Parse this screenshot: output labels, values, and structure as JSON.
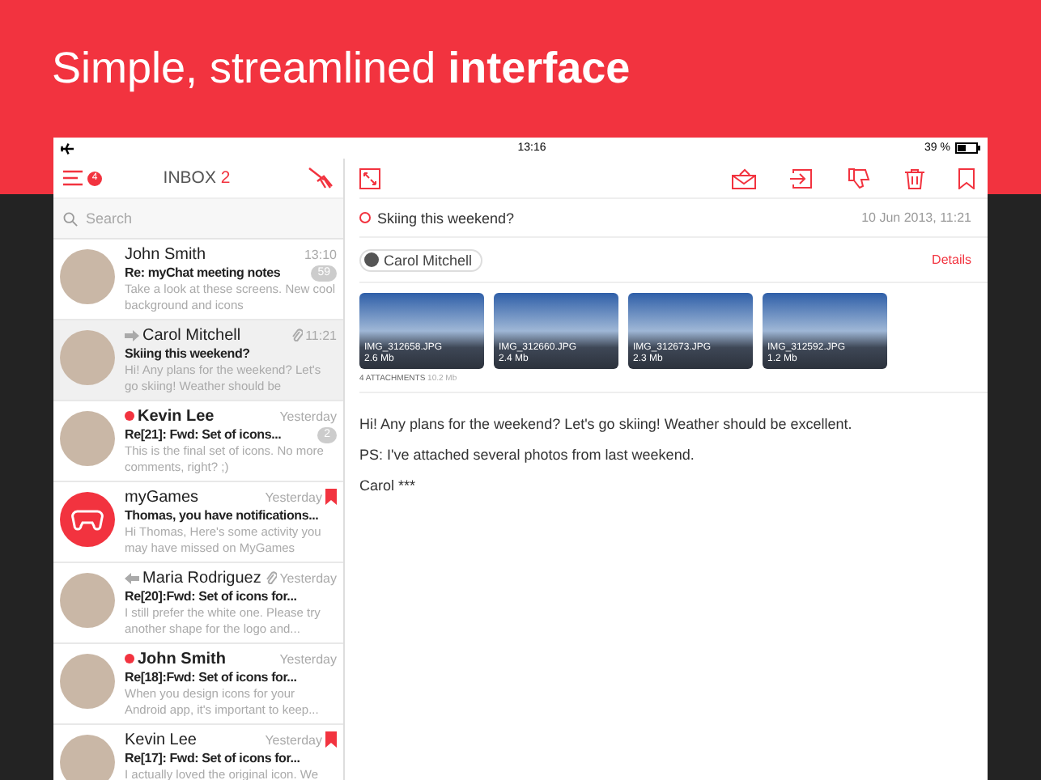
{
  "headline": "Simple, streamlined **interface**",
  "status_bar": {
    "time": "13:16",
    "battery": "39 %"
  },
  "inbox": {
    "title": "INBOX",
    "count": "2",
    "menu_badge": "4",
    "search_placeholder": "Search"
  },
  "messages": [
    {
      "kind": "photo",
      "sender": "John Smith",
      "time": "13:10",
      "subject": "Re: myChat meeting notes",
      "preview": "Take a look at these screens. New cool background and icons",
      "badge": "59",
      "unread": false,
      "flagged": false,
      "attachment": false,
      "forwarded": false,
      "replied": false,
      "selected": false
    },
    {
      "kind": "photo",
      "sender": "Carol Mitchell",
      "time": "11:21",
      "subject": "Skiing this weekend?",
      "preview": "Hi! Any plans for the weekend? Let's go skiing! Weather should be",
      "unread": false,
      "flagged": false,
      "attachment": true,
      "forwarded": true,
      "replied": false,
      "selected": true
    },
    {
      "kind": "photo",
      "sender": "Kevin Lee",
      "time": "Yesterday",
      "subject": "Re[21]: Fwd: Set of icons...",
      "preview": "This is the final set of icons. No more comments, right? ;)",
      "badge": "2",
      "unread": true,
      "flagged": false,
      "attachment": false,
      "forwarded": false,
      "replied": false,
      "selected": false
    },
    {
      "kind": "logo",
      "sender": "myGames",
      "time": "Yesterday",
      "subject": "Thomas, you have notifications...",
      "preview": "Hi Thomas, Here's some activity you may have missed on MyGames",
      "unread": false,
      "flagged": true,
      "attachment": false,
      "forwarded": false,
      "replied": false,
      "selected": false
    },
    {
      "kind": "photo",
      "sender": "Maria Rodriguez",
      "time": "Yesterday",
      "subject": "Re[20]:Fwd:  Set of icons for...",
      "preview": "I still prefer the white one. Please try another shape for the logo and...",
      "unread": false,
      "flagged": false,
      "attachment": true,
      "forwarded": false,
      "replied": true,
      "selected": false
    },
    {
      "kind": "photo",
      "sender": "John Smith",
      "time": "Yesterday",
      "subject": "Re[18]:Fwd:  Set of icons for...",
      "preview": "When you design icons for your Android app, it's important to keep...",
      "unread": true,
      "flagged": false,
      "attachment": false,
      "forwarded": false,
      "replied": false,
      "selected": false
    },
    {
      "kind": "photo",
      "sender": "Kevin Lee",
      "time": "Yesterday",
      "subject": "Re[17]: Fwd: Set of icons for...",
      "preview": "I actually loved the original icon. We",
      "unread": false,
      "flagged": true,
      "attachment": false,
      "forwarded": false,
      "replied": false,
      "selected": false
    }
  ],
  "message": {
    "subject": "Skiing this weekend?",
    "date": "10 Jun 2013, 11:21",
    "sender": "Carol Mitchell",
    "details": "Details",
    "attachments": [
      {
        "name": "IMG_312658.JPG",
        "size": "2.6 Mb"
      },
      {
        "name": "IMG_312660.JPG",
        "size": "2.4 Mb"
      },
      {
        "name": "IMG_312673.JPG",
        "size": "2.3 Mb"
      },
      {
        "name": "IMG_312592.JPG",
        "size": "1.2 Mb"
      }
    ],
    "attachments_label": "4 ATTACHMENTS",
    "attachments_total": "10.2 Mb",
    "body": [
      "Hi! Any plans for the weekend? Let's go skiing! Weather should be excellent.",
      "PS: I've attached several photos from last weekend.",
      "Carol ***"
    ]
  }
}
